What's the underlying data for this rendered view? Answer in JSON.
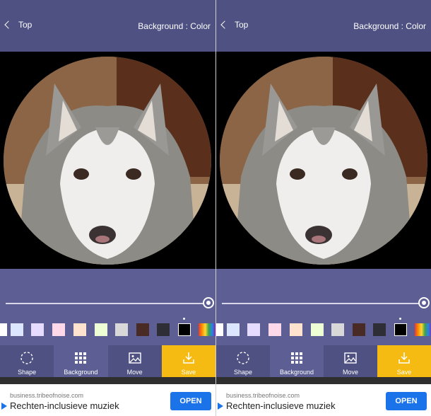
{
  "panels": [
    {
      "header": {
        "back_label": "Top",
        "background_label": "Background : Color"
      },
      "slider": {
        "value": 1.0
      },
      "palette": [
        {
          "color": "#ffffff"
        },
        {
          "color": "#dde6ff"
        },
        {
          "color": "#e6dcff"
        },
        {
          "color": "#ffd9ea"
        },
        {
          "color": "#ffe3cf"
        },
        {
          "color": "#eeffd6"
        },
        {
          "color": "#d8d8d8"
        },
        {
          "color": "#4a2a24"
        },
        {
          "color": "#2e2e36"
        },
        {
          "color": "#000000",
          "selected": true
        },
        {
          "color": "rainbow"
        }
      ],
      "toolbar": {
        "shape_label": "Shape",
        "background_label": "Background",
        "move_label": "Move",
        "save_label": "Save"
      },
      "ad": {
        "url": "business.tribeofnoise.com",
        "title": "Rechten-inclusieve muziek",
        "button": "OPEN"
      }
    },
    {
      "header": {
        "back_label": "Top",
        "background_label": "Background : Color"
      },
      "slider": {
        "value": 1.0
      },
      "palette": [
        {
          "color": "#ffffff"
        },
        {
          "color": "#dde6ff"
        },
        {
          "color": "#e6dcff"
        },
        {
          "color": "#ffd9ea"
        },
        {
          "color": "#ffe3cf"
        },
        {
          "color": "#eeffd6"
        },
        {
          "color": "#d8d8d8"
        },
        {
          "color": "#4a2a24"
        },
        {
          "color": "#2e2e36"
        },
        {
          "color": "#000000",
          "selected": true
        },
        {
          "color": "rainbow"
        }
      ],
      "toolbar": {
        "shape_label": "Shape",
        "background_label": "Background",
        "move_label": "Move",
        "save_label": "Save"
      },
      "ad": {
        "url": "business.tribeofnoise.com",
        "title": "Rechten-inclusieve muziek",
        "button": "OPEN"
      }
    }
  ],
  "colors": {
    "header": "#4e5182",
    "panel": "#5d5f94",
    "save": "#f5bb12",
    "ad_button": "#1a73e8"
  },
  "icons": {
    "back": "chevron-left-icon",
    "shape": "dashed-circle-icon",
    "background": "grid-icon",
    "move": "image-icon",
    "save": "download-icon"
  }
}
